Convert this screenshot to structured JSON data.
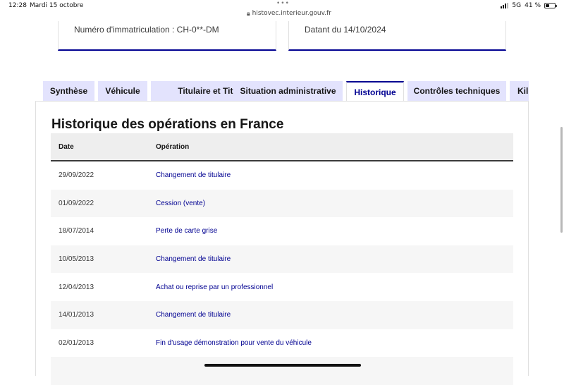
{
  "status_bar": {
    "time": "12:28",
    "date": "Mardi 15 octobre",
    "url": "histovec.interieur.gouv.fr",
    "network": "5G",
    "battery": "41 %",
    "battery_level": 0.41
  },
  "cards": {
    "left": "Numéro d'immatriculation : CH-0**-DM",
    "right": "Datant du 14/10/2024"
  },
  "tabs": [
    {
      "label": "Synthèse",
      "active": false
    },
    {
      "label": "Véhicule",
      "active": false
    },
    {
      "label": "Titulaire et Titre",
      "active": false
    },
    {
      "label": "Situation administrative",
      "active": false
    },
    {
      "label": "Historique",
      "active": true
    },
    {
      "label": "Contrôles techniques",
      "active": false
    },
    {
      "label": "Kil",
      "active": false
    }
  ],
  "section": {
    "title": "Historique des opérations en France"
  },
  "table": {
    "headers": {
      "date": "Date",
      "operation": "Opération"
    },
    "rows": [
      {
        "date": "29/09/2022",
        "operation": "Changement de titulaire"
      },
      {
        "date": "01/09/2022",
        "operation": "Cession (vente)"
      },
      {
        "date": "18/07/2014",
        "operation": "Perte de carte grise"
      },
      {
        "date": "10/05/2013",
        "operation": "Changement de titulaire"
      },
      {
        "date": "12/04/2013",
        "operation": "Achat ou reprise par un professionnel"
      },
      {
        "date": "14/01/2013",
        "operation": "Changement de titulaire"
      },
      {
        "date": "02/01/2013",
        "operation": "Fin d'usage démonstration pour vente du véhicule"
      }
    ]
  },
  "colors": {
    "primary": "#000091",
    "tab_bg": "#e3e3fd",
    "row_alt": "#f6f6f6",
    "header_bg": "#eeeeee"
  }
}
